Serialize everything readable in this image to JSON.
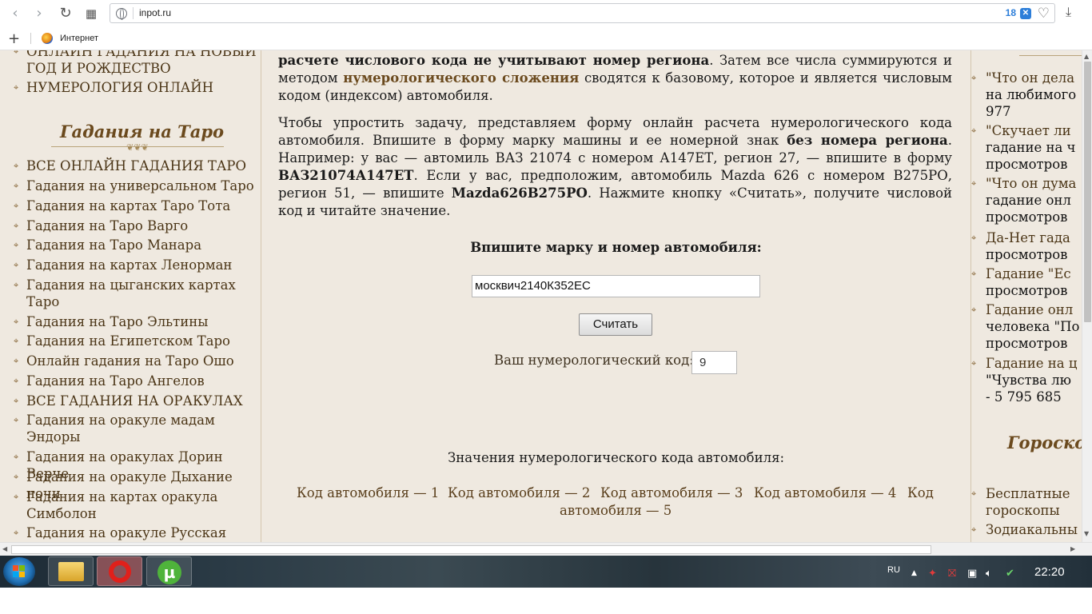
{
  "browser": {
    "url": "inpot.ru",
    "badge_count": "18",
    "bookmark_label": "Интернет"
  },
  "left_menu_top": [
    "ОНЛАЙН ГАДАНИЯ НА НОВЫЙ ГОД И РОЖДЕСТВО",
    "НУМЕРОЛОГИЯ ОНЛАЙН"
  ],
  "tarot_section": {
    "title": "Гадания на Таро",
    "items": [
      "ВСЕ ОНЛАЙН ГАДАНИЯ ТАРО",
      "Гадания на универсальном Таро",
      "Гадания на картах Таро Тота",
      "Гадания на Таро Варго",
      "Гадания на Таро Манара",
      "Гадания на картах Ленорман",
      "Гадания на цыганских картах Таро",
      "Гадания на Таро Эльтины",
      "Гадания на Египетском Таро",
      "Онлайн гадания на Таро Ошо",
      "Гадания на Таро Ангелов",
      "ВСЕ ГАДАНИЯ НА ОРАКУЛАХ",
      "Гадания на оракуле мадам Эндоры",
      "Гадания на оракулах Дорин Верче",
      "Гадания на оракуле Дыхание ночи",
      "Гадания на картах оракула Симболон",
      "Гадания на оракуле Русская"
    ]
  },
  "article": {
    "p1_bold": "расчете числового кода не учитывают номер региона",
    "p1_a": ". Затем все числа суммируются и методом ",
    "p1_link": "нумерологического сложения",
    "p1_b": " сводятся к базовому, которое и является числовым кодом (индексом) автомобиля.",
    "p2_a": "Чтобы упростить задачу, представляем форму онлайн расчета нумерологического кода автомобиля. Впишите в форму марку машины и ее номерной знак ",
    "p2_bold1": "без номера региона",
    "p2_b": ". Например: у вас — автомиль ВАЗ 21074 с номером А147ЕТ, регион 27, — впишите в форму ",
    "p2_bold2": "ВАЗ21074А147ЕТ",
    "p2_c": ". Если у вас, предположим, автомобиль Mazda 626 с номером В275РО, регион 51, — впишите ",
    "p2_bold3": "Mazda626В275РО",
    "p2_d": ". Нажмите кнопку «Считать», получите числовой код и читайте значение."
  },
  "form": {
    "title": "Впишите марку и номер автомобиля:",
    "input_value": "москвич2140К352ЕС",
    "button_label": "Считать",
    "result_label": "Ваш нумерологический код:",
    "result_value": "9"
  },
  "values": {
    "title": "Значения нумерологического кода автомобиля:",
    "links": [
      "Код автомобиля — 1",
      "Код автомобиля — 2",
      "Код автомобиля — 3",
      "Код автомобиля — 4",
      "Код",
      "автомобиля — 5"
    ]
  },
  "right_col": {
    "title": "Гороско",
    "items": [
      {
        "l1": "\"Что он дела",
        "l2": "на любимого",
        "l3": "977"
      },
      {
        "l1": "\"Скучает ли",
        "l2": "гадание на ч",
        "l3": "просмотров"
      },
      {
        "l1": "\"Что он дума",
        "l2": "гадание онл",
        "l3": "просмотров"
      },
      {
        "l1": "Да-Нет гада",
        "l2": "просмотров",
        "l3": ""
      },
      {
        "l1": "Гадание \"Ес",
        "l2": "просмотров",
        "l3": ""
      },
      {
        "l1": "Гадание онл",
        "l2": "человека \"По",
        "l3": "просмотров"
      },
      {
        "l1": "Гадание на ц",
        "l2": "\"Чувства лю",
        "l3": "- 5 795 685"
      }
    ],
    "horo_items": [
      {
        "l1": "Бесплатные",
        "l2": "гороскопы"
      },
      {
        "l1": "Зодиакальны",
        "l2": ""
      }
    ]
  },
  "taskbar": {
    "lang": "RU",
    "clock": "22:20"
  }
}
